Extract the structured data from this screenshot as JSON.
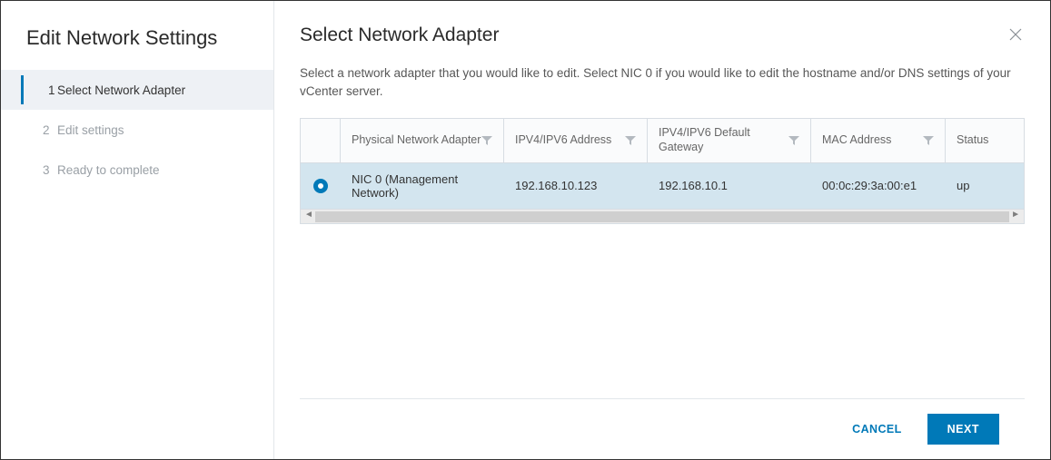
{
  "wizard": {
    "title": "Edit Network Settings",
    "steps": [
      {
        "num": "1",
        "label": "Select Network Adapter",
        "active": true
      },
      {
        "num": "2",
        "label": "Edit settings",
        "active": false
      },
      {
        "num": "3",
        "label": "Ready to complete",
        "active": false
      }
    ]
  },
  "main": {
    "title": "Select Network Adapter",
    "description": "Select a network adapter that you would like to edit. Select NIC 0 if you would like to edit the hostname and/or DNS settings of your vCenter server."
  },
  "table": {
    "columns": {
      "adapter": "Physical Network Adapter",
      "address": "IPV4/IPV6 Address",
      "gateway": "IPV4/IPV6 Default Gateway",
      "mac": "MAC Address",
      "status": "Status"
    },
    "rows": [
      {
        "selected": true,
        "adapter": "NIC 0 (Management Network)",
        "address": "192.168.10.123",
        "gateway": "192.168.10.1",
        "mac": "00:0c:29:3a:00:e1",
        "status": "up"
      }
    ]
  },
  "footer": {
    "cancel": "CANCEL",
    "next": "NEXT"
  }
}
